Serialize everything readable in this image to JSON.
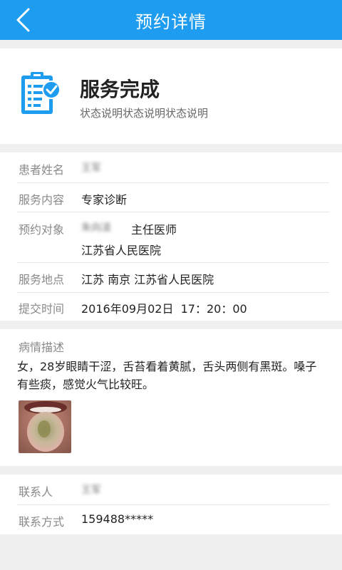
{
  "header": {
    "title": "预约详情"
  },
  "status": {
    "title": "服务完成",
    "description": "状态说明状态说明状态说明"
  },
  "info": {
    "patient_name_label": "患者姓名",
    "patient_name_value": "王军",
    "service_content_label": "服务内容",
    "service_content_value": "专家诊断",
    "target_label": "预约对象",
    "doctor_name": "朱向凌",
    "doctor_title": "主任医师",
    "hospital": "江苏省人民医院",
    "location_label": "服务地点",
    "location_value": "江苏 南京 江苏省人民医院",
    "submit_time_label": "提交时间",
    "submit_time_value": "2016年09月02日  17：20：00"
  },
  "condition": {
    "label": "病情描述",
    "text": "女，28岁眼睛干涩，舌苔看着黄腻，舌头两侧有黑斑。嗓子有些痰，感觉火气比较旺。"
  },
  "contact": {
    "person_label": "联系人",
    "person_value": "王军",
    "phone_label": "联系方式",
    "phone_value": "159488*****"
  },
  "colors": {
    "accent": "#1e9cef",
    "background": "#f0f0f0"
  },
  "icons": {
    "back": "chevron-left-icon",
    "status": "clipboard-check-icon"
  }
}
